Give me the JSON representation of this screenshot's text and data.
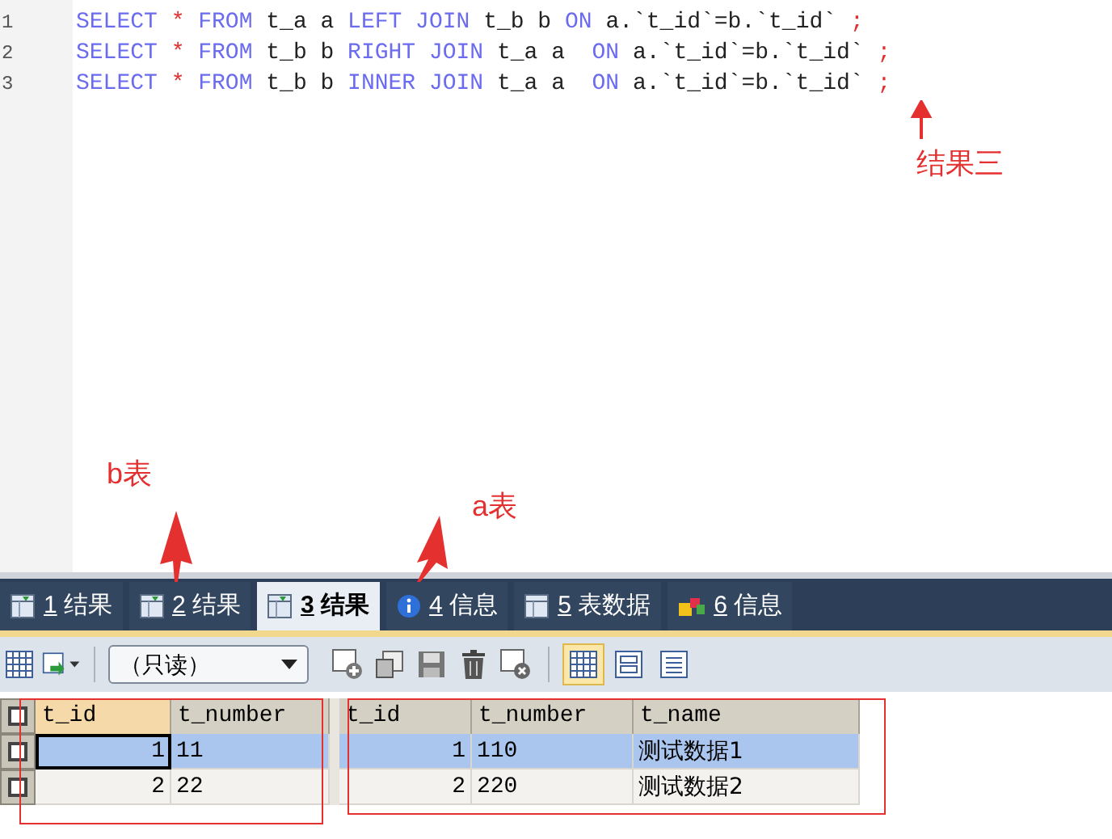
{
  "editor": {
    "lines": [
      {
        "number": "1",
        "tokens": [
          {
            "kind": "kw",
            "text": "SELECT "
          },
          {
            "kind": "op",
            "text": "* "
          },
          {
            "kind": "kw",
            "text": "FROM"
          },
          {
            "kind": "id",
            "text": " t_a a "
          },
          {
            "kind": "kw",
            "text": "LEFT JOIN"
          },
          {
            "kind": "id",
            "text": " t_b b "
          },
          {
            "kind": "kw",
            "text": "ON"
          },
          {
            "kind": "id",
            "text": " a.`t_id`=b.`t_id` "
          },
          {
            "kind": "op",
            "text": ";"
          }
        ]
      },
      {
        "number": "2",
        "tokens": [
          {
            "kind": "kw",
            "text": "SELECT "
          },
          {
            "kind": "op",
            "text": "* "
          },
          {
            "kind": "kw",
            "text": "FROM"
          },
          {
            "kind": "id",
            "text": " t_b b "
          },
          {
            "kind": "kw",
            "text": "RIGHT JOIN"
          },
          {
            "kind": "id",
            "text": " t_a a  "
          },
          {
            "kind": "kw",
            "text": "ON"
          },
          {
            "kind": "id",
            "text": " a.`t_id`=b.`t_id` "
          },
          {
            "kind": "op",
            "text": ";"
          }
        ]
      },
      {
        "number": "3",
        "tokens": [
          {
            "kind": "kw",
            "text": "SELECT "
          },
          {
            "kind": "op",
            "text": "* "
          },
          {
            "kind": "kw",
            "text": "FROM"
          },
          {
            "kind": "id",
            "text": " t_b b "
          },
          {
            "kind": "kw",
            "text": "INNER JOIN"
          },
          {
            "kind": "id",
            "text": " t_a a  "
          },
          {
            "kind": "kw",
            "text": "ON"
          },
          {
            "kind": "id",
            "text": " a.`t_id`=b.`t_id` "
          },
          {
            "kind": "op",
            "text": ";"
          }
        ]
      }
    ]
  },
  "tabs": [
    {
      "number": "1",
      "label": "结果",
      "kind": "result",
      "selected": false
    },
    {
      "number": "2",
      "label": "结果",
      "kind": "result",
      "selected": false
    },
    {
      "number": "3",
      "label": "结果",
      "kind": "result",
      "selected": true
    },
    {
      "number": "4",
      "label": "信息",
      "kind": "info",
      "selected": false
    },
    {
      "number": "5",
      "label": "表数据",
      "kind": "table",
      "selected": false
    },
    {
      "number": "6",
      "label": "信息",
      "kind": "profile",
      "selected": false
    }
  ],
  "toolbar": {
    "mode": "（只读）",
    "views": [
      {
        "kind": "grid",
        "selected": true
      },
      {
        "kind": "form",
        "selected": false
      },
      {
        "kind": "text",
        "selected": false
      }
    ]
  },
  "grid": {
    "columns": [
      {
        "label": "t_id",
        "selected": true
      },
      {
        "label": "t_number",
        "selected": false
      },
      {
        "label": "t_id",
        "selected": false
      },
      {
        "label": "t_number",
        "selected": false
      },
      {
        "label": "t_name",
        "selected": false
      }
    ],
    "rows": [
      {
        "selected": true,
        "cells": [
          "1",
          "11",
          "1",
          "110",
          "测试数据1"
        ]
      },
      {
        "selected": false,
        "cells": [
          "2",
          "22",
          "2",
          "220",
          "测试数据2"
        ]
      }
    ]
  },
  "annotations": [
    {
      "text": "结果三"
    },
    {
      "text": "b表"
    },
    {
      "text": "a表"
    }
  ]
}
